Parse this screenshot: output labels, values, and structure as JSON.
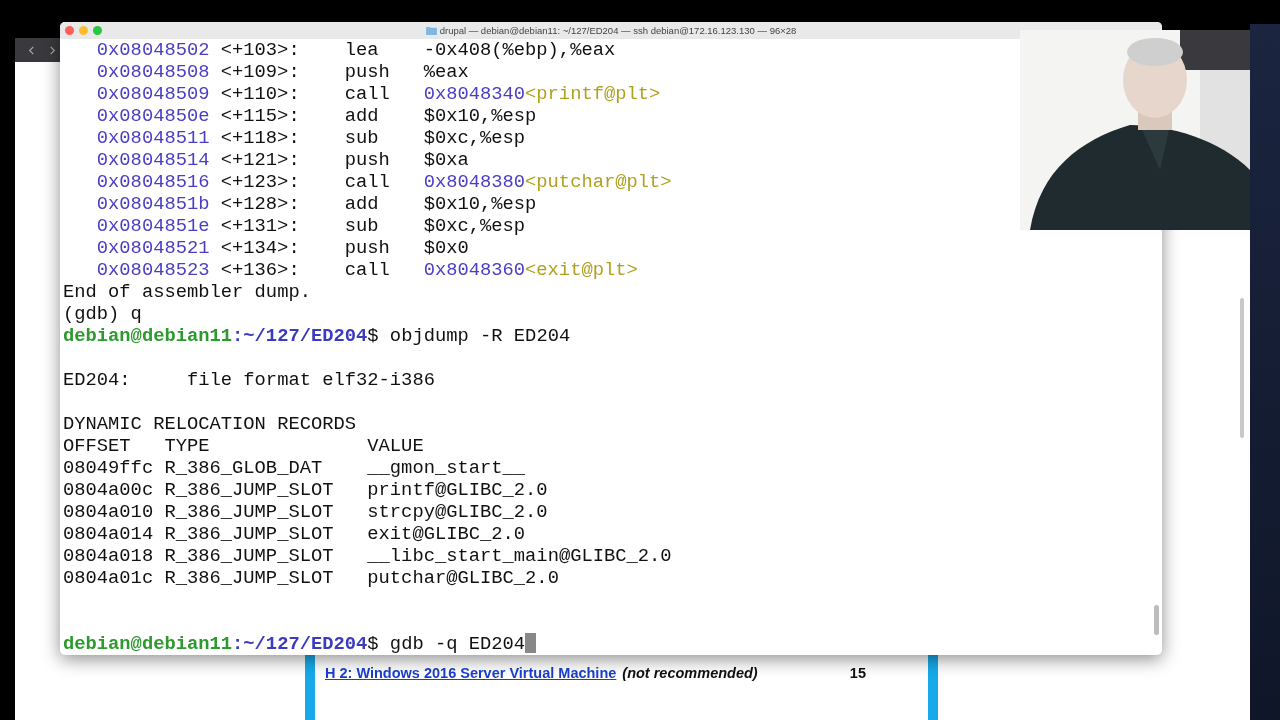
{
  "terminal": {
    "title": "drupal — debian@debian11: ~/127/ED204 — ssh debian@172.16.123.130 — 96×28",
    "lines": [
      {
        "kind": "asm",
        "address": "0x08048502",
        "offset": "<+103>:",
        "mnemonic": "lea",
        "operands": "-0x408(%ebp),%eax"
      },
      {
        "kind": "asm",
        "address": "0x08048508",
        "offset": "<+109>:",
        "mnemonic": "push",
        "operands": "%eax"
      },
      {
        "kind": "asm",
        "address": "0x08048509",
        "offset": "<+110>:",
        "mnemonic": "call",
        "operands": "0x8048340",
        "symbol": "<printf@plt>"
      },
      {
        "kind": "asm",
        "address": "0x0804850e",
        "offset": "<+115>:",
        "mnemonic": "add",
        "operands": "$0x10,%esp"
      },
      {
        "kind": "asm",
        "address": "0x08048511",
        "offset": "<+118>:",
        "mnemonic": "sub",
        "operands": "$0xc,%esp"
      },
      {
        "kind": "asm",
        "address": "0x08048514",
        "offset": "<+121>:",
        "mnemonic": "push",
        "operands": "$0xa"
      },
      {
        "kind": "asm",
        "address": "0x08048516",
        "offset": "<+123>:",
        "mnemonic": "call",
        "operands": "0x8048380",
        "symbol": "<putchar@plt>"
      },
      {
        "kind": "asm",
        "address": "0x0804851b",
        "offset": "<+128>:",
        "mnemonic": "add",
        "operands": "$0x10,%esp"
      },
      {
        "kind": "asm",
        "address": "0x0804851e",
        "offset": "<+131>:",
        "mnemonic": "sub",
        "operands": "$0xc,%esp"
      },
      {
        "kind": "asm",
        "address": "0x08048521",
        "offset": "<+134>:",
        "mnemonic": "push",
        "operands": "$0x0"
      },
      {
        "kind": "asm",
        "address": "0x08048523",
        "offset": "<+136>:",
        "mnemonic": "call",
        "operands": "0x8048360",
        "symbol": "<exit@plt>"
      },
      {
        "kind": "text",
        "text": "End of assembler dump."
      },
      {
        "kind": "text",
        "text": "(gdb) q"
      },
      {
        "kind": "prompt",
        "user": "debian@debian11",
        "path": ":~/127/ED204",
        "sign": "$",
        "command": "objdump -R ED204",
        "cursor": false
      },
      {
        "kind": "blank"
      },
      {
        "kind": "text",
        "text": "ED204:     file format elf32-i386"
      },
      {
        "kind": "blank"
      },
      {
        "kind": "text",
        "text": "DYNAMIC RELOCATION RECORDS"
      },
      {
        "kind": "text",
        "text": "OFFSET   TYPE              VALUE"
      },
      {
        "kind": "text",
        "text": "08049ffc R_386_GLOB_DAT    __gmon_start__"
      },
      {
        "kind": "text",
        "text": "0804a00c R_386_JUMP_SLOT   printf@GLIBC_2.0"
      },
      {
        "kind": "text",
        "text": "0804a010 R_386_JUMP_SLOT   strcpy@GLIBC_2.0"
      },
      {
        "kind": "text",
        "text": "0804a014 R_386_JUMP_SLOT   exit@GLIBC_2.0"
      },
      {
        "kind": "text",
        "text": "0804a018 R_386_JUMP_SLOT   __libc_start_main@GLIBC_2.0"
      },
      {
        "kind": "text",
        "text": "0804a01c R_386_JUMP_SLOT   putchar@GLIBC_2.0"
      },
      {
        "kind": "blank"
      },
      {
        "kind": "blank"
      },
      {
        "kind": "prompt",
        "user": "debian@debian11",
        "path": ":~/127/ED204",
        "sign": "$",
        "command": "gdb -q ED204",
        "cursor": true
      }
    ]
  },
  "webpage": {
    "heading_link": "H 2: Windows 2016 Server Virtual Machine",
    "note": "(not recommended)",
    "page": "15"
  }
}
